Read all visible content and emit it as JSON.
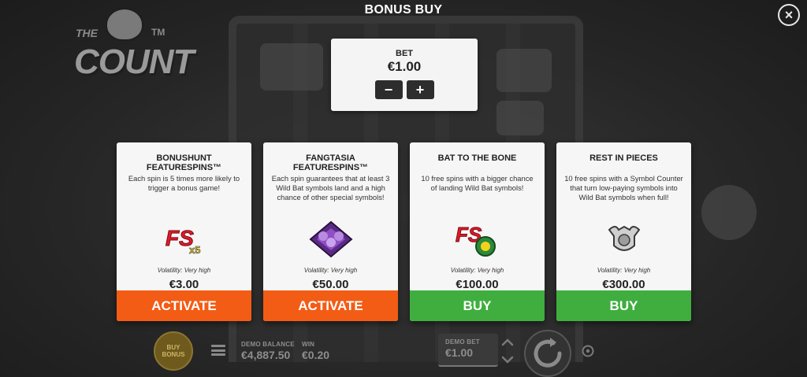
{
  "header": {
    "title": "BONUS BUY",
    "close_symbol": "×"
  },
  "logo": {
    "prefix": "THE",
    "name": "COUNT",
    "tm": "TM"
  },
  "bet": {
    "label": "BET",
    "value": "€1.00",
    "minus": "−",
    "plus": "+"
  },
  "cards": [
    {
      "title": "BONUSHUNT FEATURESPINS™",
      "description": "Each spin is 5 times more likely to trigger a bonus game!",
      "icon": "fs-x5-icon",
      "icon_text": "FS",
      "icon_badge": "x5",
      "volatility": "Volatility: Very high",
      "price": "€3.00",
      "action": "ACTIVATE",
      "action_color": "#f35c15"
    },
    {
      "title": "FANGTASIA FEATURESPINS™",
      "description": "Each spin guarantees that at least 3 Wild Bat symbols land and a high chance of other special symbols!",
      "icon": "bat-cluster-icon",
      "volatility": "Volatility: Very high",
      "price": "€50.00",
      "action": "ACTIVATE",
      "action_color": "#f35c15"
    },
    {
      "title": "BAT TO THE BONE",
      "description": "10 free spins with a bigger chance of landing Wild Bat symbols!",
      "icon": "fs-bat-icon",
      "icon_text": "FS",
      "volatility": "Volatility: Very high",
      "price": "€100.00",
      "action": "BUY",
      "action_color": "#3fae3f"
    },
    {
      "title": "REST IN PIECES",
      "description": "10 free spins with a Symbol Counter that turn low-paying symbols into Wild Bat symbols when full!",
      "icon": "bat-emblem-icon",
      "volatility": "Volatility: Very high",
      "price": "€300.00",
      "action": "BUY",
      "action_color": "#3fae3f"
    }
  ],
  "bottom_bar": {
    "buy_bonus_line1": "BUY",
    "buy_bonus_line2": "BONUS",
    "demo_balance_label": "DEMO BALANCE",
    "demo_balance_value": "€4,887.50",
    "win_label": "WIN",
    "win_value": "€0.20",
    "demo_bet_label": "DEMO BET",
    "demo_bet_value": "€1.00"
  }
}
